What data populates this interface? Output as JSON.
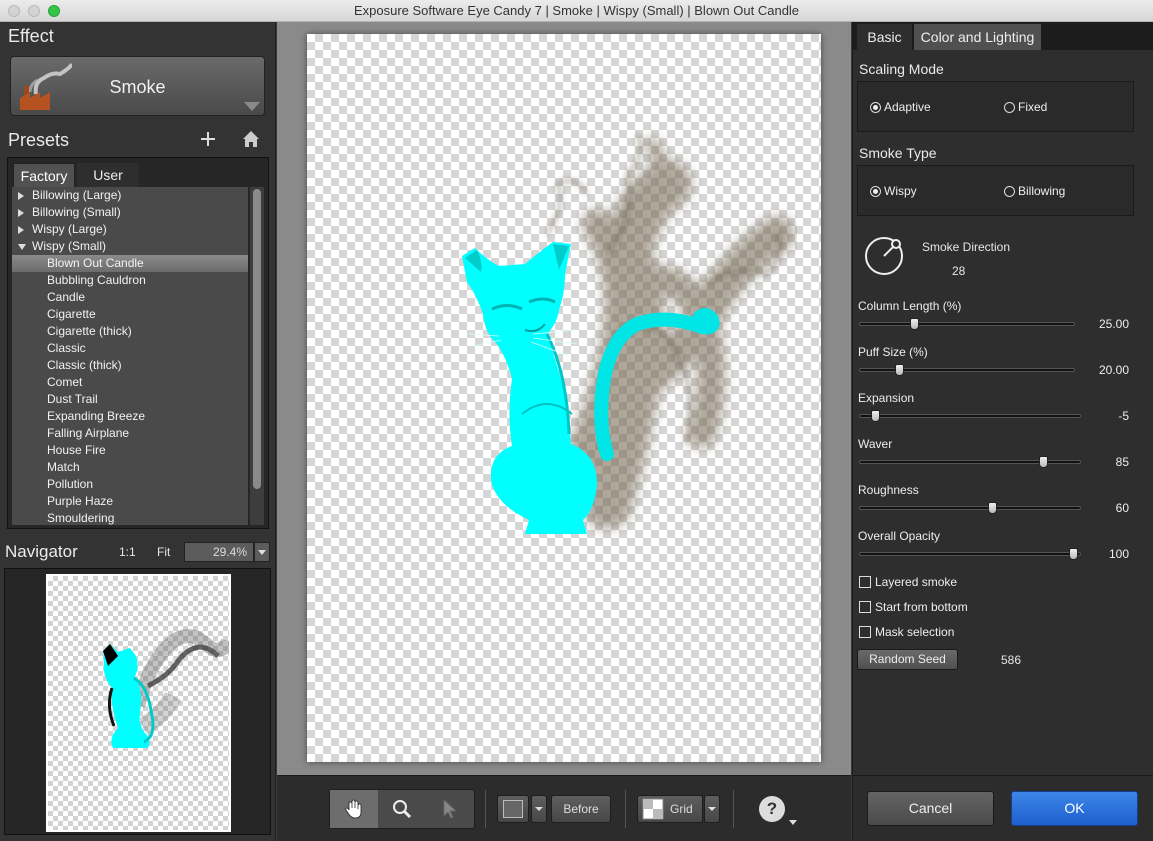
{
  "window": {
    "title": "Exposure Software Eye Candy 7 | Smoke | Wispy (Small) | Blown Out Candle"
  },
  "effect": {
    "section_title": "Effect",
    "name": "Smoke"
  },
  "presets": {
    "section_title": "Presets",
    "tabs": [
      "Factory",
      "User"
    ],
    "groups": [
      {
        "label": "Billowing (Large)",
        "expanded": false
      },
      {
        "label": "Billowing (Small)",
        "expanded": false
      },
      {
        "label": "Wispy (Large)",
        "expanded": false
      },
      {
        "label": "Wispy (Small)",
        "expanded": true
      }
    ],
    "items": [
      "Blown Out Candle",
      "Bubbling Cauldron",
      "Candle",
      "Cigarette",
      "Cigarette (thick)",
      "Classic",
      "Classic (thick)",
      "Comet",
      "Dust Trail",
      "Expanding Breeze",
      "Falling Airplane",
      "House Fire",
      "Match",
      "Pollution",
      "Purple Haze",
      "Smouldering"
    ],
    "selected": "Blown Out Candle"
  },
  "navigator": {
    "title": "Navigator",
    "one_to_one": "1:1",
    "fit": "Fit",
    "zoom": "29.4%"
  },
  "toolbar": {
    "before_label": "Before",
    "grid_label": "Grid",
    "help_symbol": "?"
  },
  "settings": {
    "tabs": [
      "Basic",
      "Color and Lighting"
    ],
    "scaling_mode": {
      "label": "Scaling Mode",
      "options": [
        "Adaptive",
        "Fixed"
      ],
      "selected": "Adaptive"
    },
    "smoke_type": {
      "label": "Smoke Type",
      "options": [
        "Wispy",
        "Billowing"
      ],
      "selected": "Wispy"
    },
    "smoke_direction": {
      "label": "Smoke Direction",
      "value": "28"
    },
    "sliders": [
      {
        "label": "Column Length (%)",
        "value": "25.00",
        "fraction": 0.25
      },
      {
        "label": "Puff Size (%)",
        "value": "20.00",
        "fraction": 0.18
      },
      {
        "label": "Expansion",
        "value": "-5",
        "fraction": 0.07
      },
      {
        "label": "Waver",
        "value": "85",
        "fraction": 0.83
      },
      {
        "label": "Roughness",
        "value": "60",
        "fraction": 0.6
      },
      {
        "label": "Overall Opacity",
        "value": "100",
        "fraction": 0.97
      }
    ],
    "checkboxes": [
      {
        "label": "Layered smoke",
        "checked": false
      },
      {
        "label": "Start from bottom",
        "checked": false
      },
      {
        "label": "Mask selection",
        "checked": false
      }
    ],
    "random_seed": {
      "label": "Random Seed",
      "value": "586"
    }
  },
  "dialog": {
    "cancel_label": "Cancel",
    "ok_label": "OK"
  },
  "colors": {
    "accent": "#1e5fce",
    "subject": "#00ffff",
    "smoke": "#7a6a55"
  }
}
